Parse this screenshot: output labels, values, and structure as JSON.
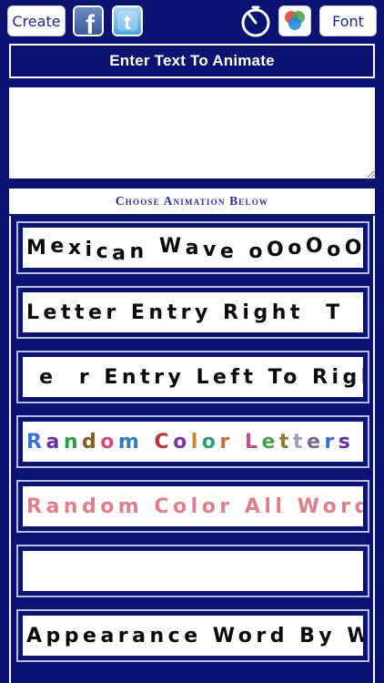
{
  "toolbar": {
    "create_label": "Create",
    "font_label": "Font",
    "facebook_glyph": "f",
    "twitter_glyph": "t",
    "icons": [
      "facebook-icon",
      "twitter-icon",
      "timer-icon",
      "color-wheel-icon"
    ]
  },
  "header": {
    "title": "Enter Text To Animate"
  },
  "input": {
    "value": "",
    "placeholder": ""
  },
  "section": {
    "choose_label": "Choose Animation Below"
  },
  "colors": {
    "background": "#0b1270",
    "accent_text": "#27319b",
    "random_words": "#e07f8c",
    "letter_colors": [
      "#3b6fd6",
      "#6a2ea8",
      "#2f9c4b",
      "#8a5a1e",
      "#d24d7f",
      "#2c7fbf",
      "#b43a3a",
      "#7a3aa8",
      "#c7892a",
      "#2f9c7e",
      "#d06a2a",
      "#c74a8c",
      "#4aa14b",
      "#8c7a2e",
      "#9aa0b0",
      "#7a6a8a"
    ]
  },
  "animations": [
    {
      "label": "Mexican Wave oOoOoOo"
    },
    {
      "label": "Letter Entry Right  T"
    },
    {
      "label": " e  r Entry Left To Right"
    },
    {
      "label": "Random Color Letters"
    },
    {
      "label": "Random Color All Words"
    },
    {
      "label": ""
    },
    {
      "label": "Appearance Word By Word"
    }
  ]
}
